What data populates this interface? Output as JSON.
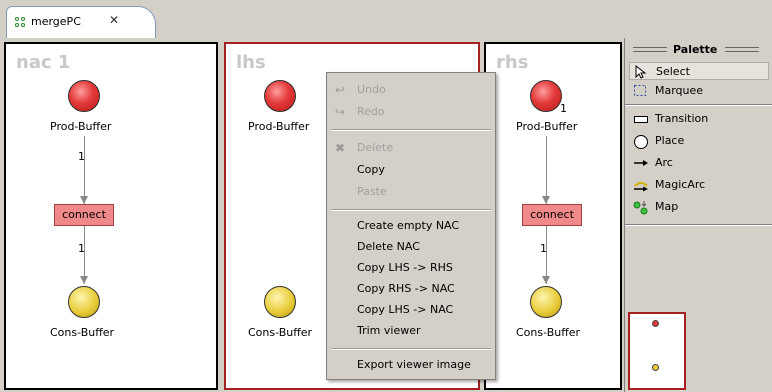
{
  "tab": {
    "label": "mergePC",
    "close": "✕"
  },
  "viewers": {
    "nac": {
      "title": "nac 1",
      "prod": "Prod-Buffer",
      "cons": "Cons-Buffer",
      "transition": "connect",
      "arc1": "1",
      "arc2": "1"
    },
    "lhs": {
      "title": "lhs",
      "prod": "Prod-Buffer",
      "cons": "Cons-Buffer"
    },
    "rhs": {
      "title": "rhs",
      "prod": "Prod-Buffer",
      "cons": "Cons-Buffer",
      "transition": "connect",
      "arc1": "1",
      "arc2": "1"
    }
  },
  "context_menu": {
    "undo": "Undo",
    "redo": "Redo",
    "delete": "Delete",
    "copy": "Copy",
    "paste": "Paste",
    "create_nac": "Create empty NAC",
    "delete_nac": "Delete NAC",
    "copy_lhs_rhs": "Copy LHS -> RHS",
    "copy_rhs_nac": "Copy RHS -> NAC",
    "copy_lhs_nac": "Copy LHS -> NAC",
    "trim_viewer": "Trim viewer",
    "export_image": "Export viewer image"
  },
  "palette": {
    "title": "Palette",
    "items": [
      "Select",
      "Marquee",
      "Transition",
      "Place",
      "Arc",
      "MagicArc",
      "Map"
    ]
  },
  "colors": {
    "place_red": "#e23a3a",
    "place_yellow": "#e8cc3a",
    "transition": "#f08a8a",
    "selected_border": "#a52020"
  }
}
